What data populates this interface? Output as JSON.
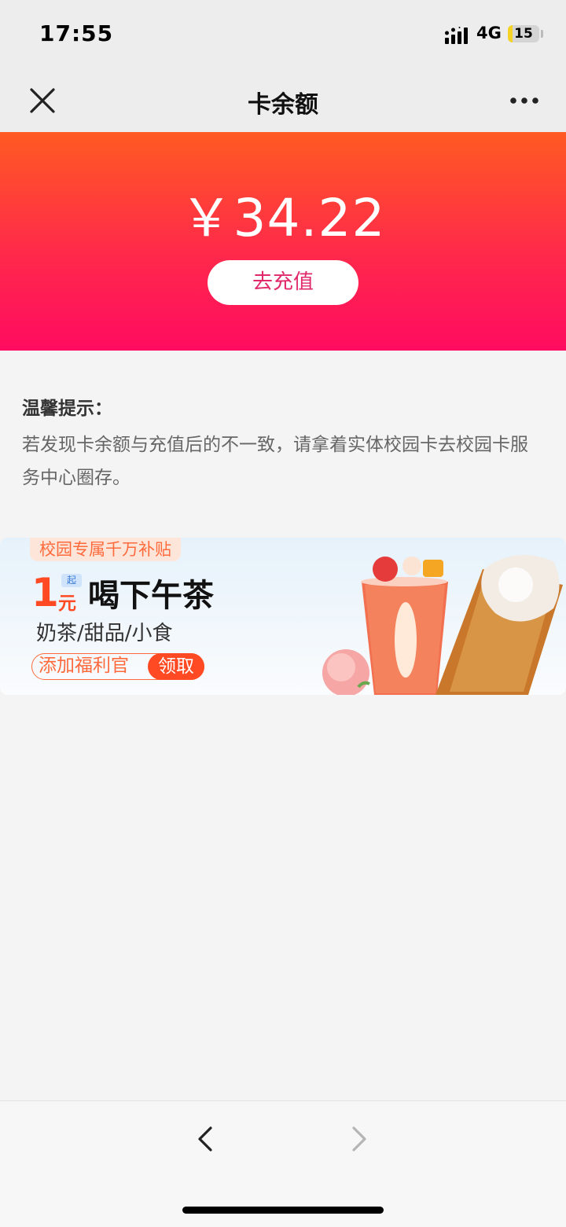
{
  "status_bar": {
    "time": "17:55",
    "network": "4G",
    "battery_level": "15",
    "battery_fraction": 0.15
  },
  "nav": {
    "title": "卡余额",
    "close_icon": "close-icon",
    "more_icon": "more-icon"
  },
  "balance": {
    "amount": "￥34.22",
    "recharge_label": "去充值"
  },
  "tips": {
    "title": "温馨提示：",
    "body": "若发现卡余额与充值后的不一致，请拿着实体校园卡去校园卡服务中心圈存。"
  },
  "promo": {
    "tag": "校园专属千万补贴",
    "price_number": "1",
    "price_qi": "起",
    "price_unit": "元",
    "headline": "喝下午茶",
    "subtitle": "奶茶/甜品/小食",
    "cta_text": "添加福利官",
    "cta_button": "领取"
  },
  "toolbar": {
    "back_icon": "chevron-left-icon",
    "forward_icon": "chevron-right-icon"
  },
  "colors": {
    "banner_top": "#ff5a22",
    "banner_bottom": "#ff0b60",
    "accent": "#ff4a23",
    "recharge_text": "#e0286a"
  }
}
